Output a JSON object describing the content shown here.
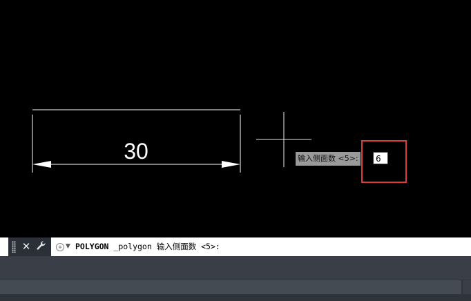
{
  "drawing": {
    "dimension_text": "30"
  },
  "dynamic_input": {
    "prompt_label": "输入侧面数 <5>:",
    "value": "6"
  },
  "command_line": {
    "command": "POLYGON",
    "rest": " _polygon 输入侧面数 <5>:"
  },
  "icons": {
    "close": "close-icon",
    "wrench": "wrench-icon",
    "prompt": "command-prompt-icon"
  },
  "colors": {
    "canvas": "#000000",
    "highlight": "#e03a3a",
    "command_bar": "#ffffff",
    "status_bar": "#3a3f47"
  }
}
